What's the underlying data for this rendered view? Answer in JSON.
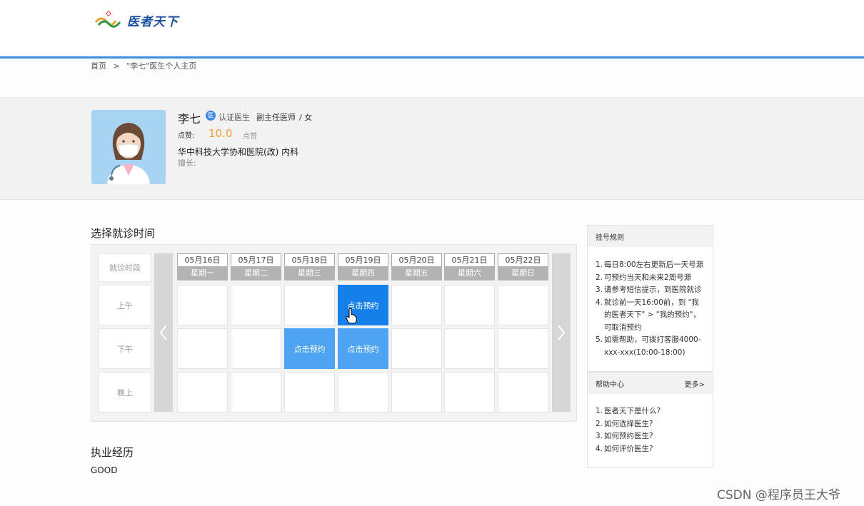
{
  "brand": {
    "logo_text": "医者天下",
    "logo_colors": [
      "#e04040",
      "#f0a030",
      "#2c9a3c",
      "#1a4fa0"
    ]
  },
  "breadcrumb": {
    "home": "首页",
    "separator": ">",
    "current": "\"李七\"医生个人主页"
  },
  "doctor": {
    "name": "李七",
    "cert_badge": "医",
    "cert_text": "认证医生",
    "title": "副主任医师",
    "gender": "/ 女",
    "likes_label": "点赞:",
    "likes_value": "10.0",
    "likes_unit": "点赞",
    "hospital": "华中科技大学协和医院(改)   内科",
    "specialty": "擅长:"
  },
  "schedule": {
    "title": "选择就诊时间",
    "slot_header": "就诊时段",
    "slots": [
      "上午",
      "下午",
      "晚上"
    ],
    "days": [
      {
        "date": "05月16日",
        "week": "星期一"
      },
      {
        "date": "05月17日",
        "week": "星期二"
      },
      {
        "date": "05月18日",
        "week": "星期三"
      },
      {
        "date": "05月19日",
        "week": "星期四"
      },
      {
        "date": "05月20日",
        "week": "星期五"
      },
      {
        "date": "05月21日",
        "week": "星期六"
      },
      {
        "date": "05月22日",
        "week": "星期日"
      }
    ],
    "book_label": "点击预约",
    "bookable": [
      {
        "slot": 0,
        "day": 3,
        "active": true
      },
      {
        "slot": 1,
        "day": 2,
        "active": false
      },
      {
        "slot": 1,
        "day": 3,
        "active": false
      }
    ],
    "prev_icon": "chevron-left-icon",
    "next_icon": "chevron-right-icon"
  },
  "rules": {
    "title": "挂号规则",
    "items": [
      {
        "num": "1.",
        "text": "每日8:00左右更新后一天号源"
      },
      {
        "num": "2.",
        "text": "可预约当天和未来2周号源"
      },
      {
        "num": "3.",
        "text": "请参考短信提示，到医院就诊"
      },
      {
        "num": "4.",
        "text": "就诊前一天16:00前，到 \"我的医者天下\" > \"我的预约\"，可取消预约"
      },
      {
        "num": "5.",
        "text": "如需帮助，可拨打客服4000-xxx-xxx(10:00-18:00)"
      }
    ]
  },
  "help": {
    "title": "帮助中心",
    "more": "更多>",
    "items": [
      {
        "num": "1.",
        "text": "医者天下是什么?"
      },
      {
        "num": "2.",
        "text": "如何选择医生?"
      },
      {
        "num": "3.",
        "text": "如何预约医生?"
      },
      {
        "num": "4.",
        "text": "如何评价医生?"
      }
    ]
  },
  "experience": {
    "title": "执业经历",
    "text": "GOOD"
  },
  "watermark": "CSDN @程序员王大爷",
  "colors": {
    "accent": "#3c8fd8",
    "book": "#4ea3f3",
    "book_active": "#1580ea",
    "likes": "#f0a030"
  }
}
